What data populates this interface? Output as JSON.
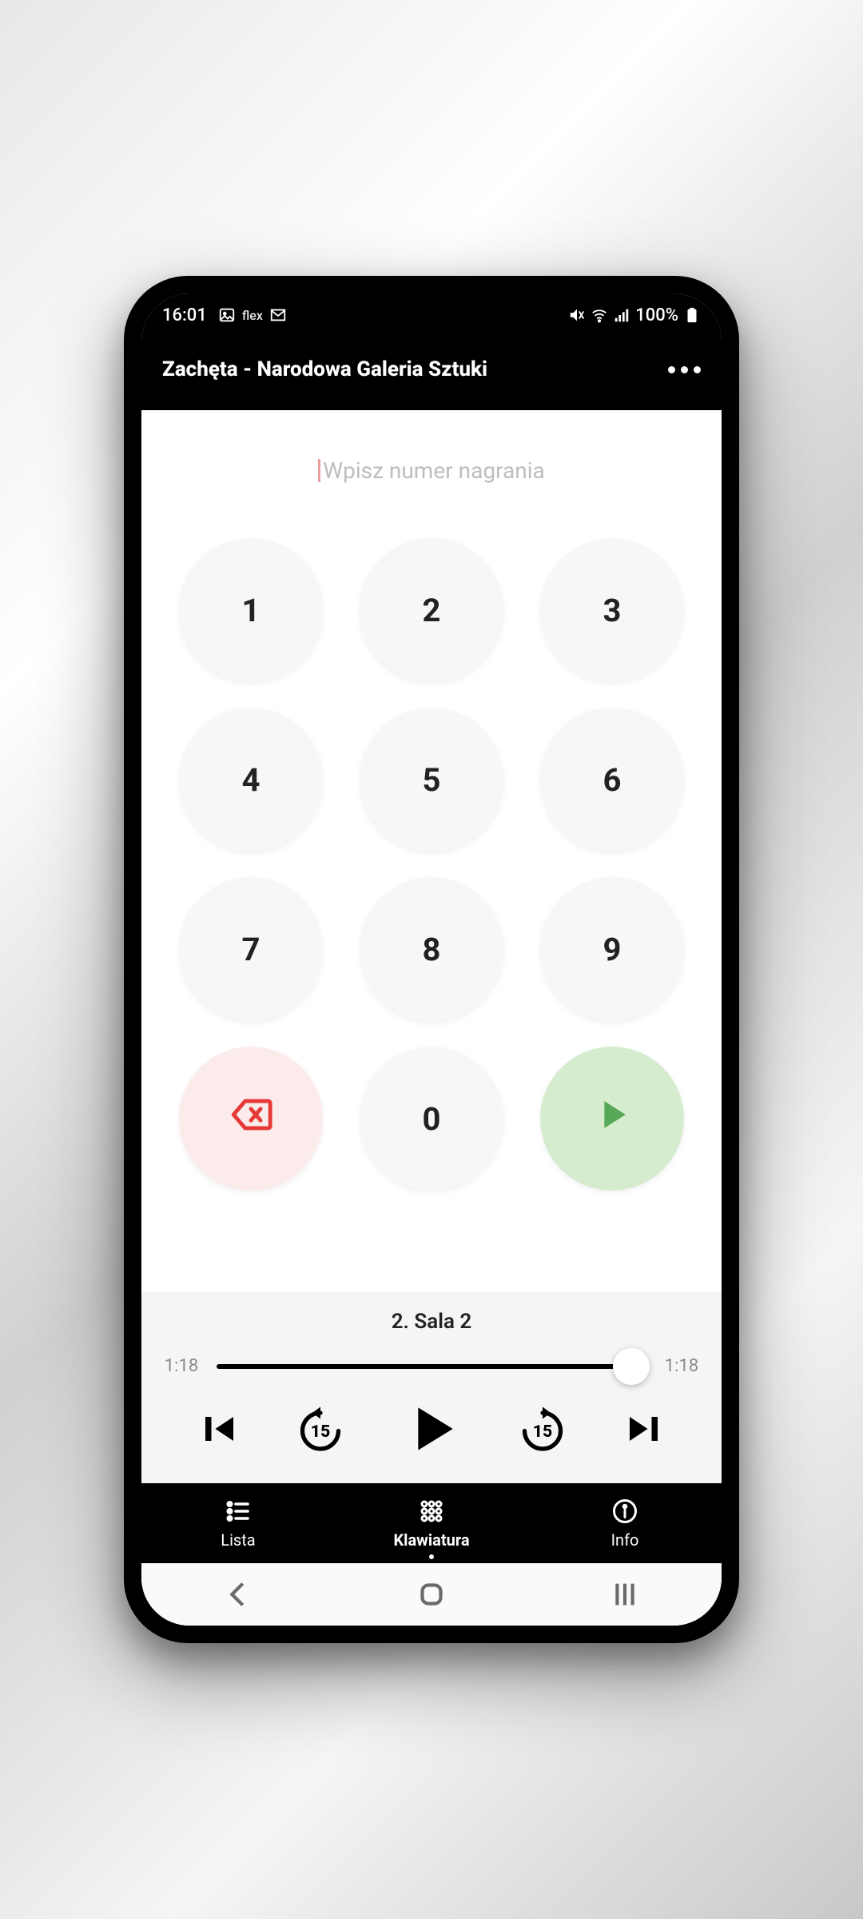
{
  "status": {
    "time": "16:01",
    "flex_label": "flex",
    "battery": "100%"
  },
  "header": {
    "title": "Zachęta - Narodowa Galeria Sztuki"
  },
  "input": {
    "placeholder": "Wpisz numer nagrania"
  },
  "keypad": {
    "keys": [
      "1",
      "2",
      "3",
      "4",
      "5",
      "6",
      "7",
      "8",
      "9",
      "",
      "0",
      ""
    ]
  },
  "player": {
    "track_title": "2. Sala 2",
    "elapsed": "1:18",
    "total": "1:18",
    "rewind_seconds": "15",
    "forward_seconds": "15"
  },
  "nav": {
    "items": [
      {
        "label": "Lista"
      },
      {
        "label": "Klawiatura"
      },
      {
        "label": "Info"
      }
    ]
  }
}
